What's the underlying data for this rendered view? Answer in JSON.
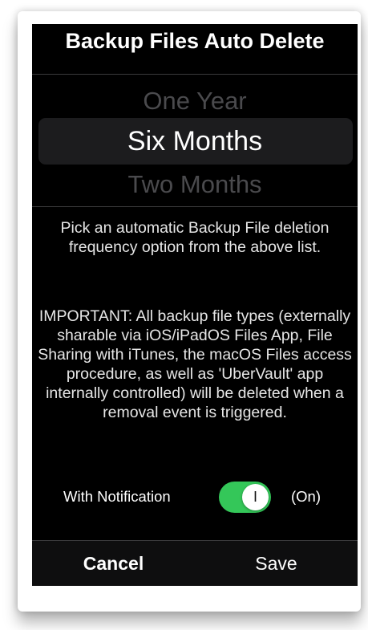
{
  "dialog": {
    "title": "Backup Files Auto Delete"
  },
  "picker": {
    "previous_option": "One Year",
    "selected_option": "Six Months",
    "next_option": "Two Months"
  },
  "description": "Pick an automatic Backup File deletion frequency option from the above list.",
  "important_notice": "IMPORTANT: All backup file types (externally sharable via iOS/iPadOS Files App, File Sharing with iTunes, the macOS Files access procedure, as well as 'UberVault' app internally controlled) will be deleted when a removal event is triggered.",
  "notification": {
    "label": "With Notification",
    "toggle_on": true,
    "toggle_glyph": "I",
    "state_text": "(On)",
    "toggle_color": "#34c759"
  },
  "footer": {
    "cancel_label": "Cancel",
    "save_label": "Save"
  }
}
